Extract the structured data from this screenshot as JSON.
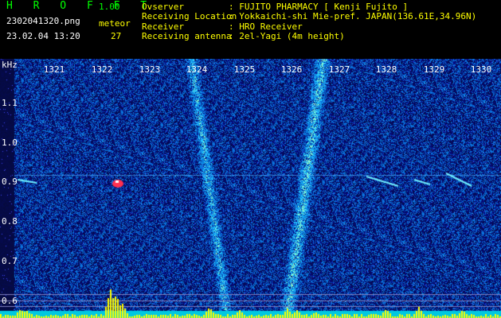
{
  "app": {
    "title": "H R O F F T",
    "version": "1.00"
  },
  "file": {
    "name": "2302041320.png",
    "datetime": "23.02.04 13:20"
  },
  "meteor": {
    "label": "meteor",
    "count": "27"
  },
  "info": [
    {
      "label": "Ovserver",
      "value": ": FUJITO PHARMACY [ Kenji Fujito ]"
    },
    {
      "label": "Receiving Location",
      "value": ": Yokkaichi-shi Mie-pref. JAPAN(136.61E,34.96N)"
    },
    {
      "label": "Receiver",
      "value": ": HRO Receiver"
    },
    {
      "label": "Receiving antenna",
      "value": ": 2el-Yagi (4m height)"
    }
  ],
  "axis": {
    "unit": "kHz",
    "yticks": [
      "1.1",
      "1.0",
      "0.9",
      "0.8",
      "0.7",
      "0.6"
    ],
    "xticks": [
      "1321",
      "1322",
      "1323",
      "1324",
      "1325",
      "1326",
      "1327",
      "1328",
      "1329",
      "1330"
    ]
  },
  "colors": {
    "bg": "#000022",
    "noise": "#0a1a9a",
    "echo": "#4fe0ff",
    "meteor": "#ff3050",
    "level": "#ffff00",
    "base": "#00ffff"
  }
}
